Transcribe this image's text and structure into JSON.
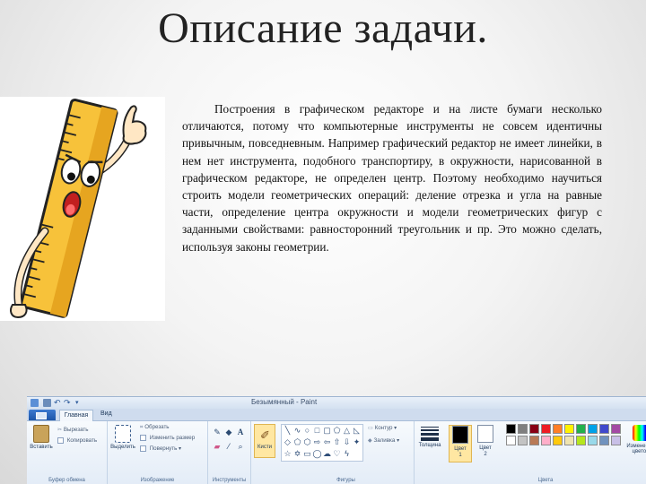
{
  "slide": {
    "title": "Описание задачи.",
    "body": "Построения в графическом редакторе и на листе бумаги несколько отличаются, потому что компьютерные инструменты не совсем идентичны привычным, повседневным. Например графический редактор не имеет линейки, в нем нет инструмента, подобного транспортиру, в окружности, нарисованной в графическом редакторе, не определен центр. Поэтому необходимо научиться строить модели геометрических операций: деление отрезка и угла на равные части, определение центра окружности и модели геометрических фигур с заданными свойствами: равносторонний треугольник и пр.  Это можно сделать, используя законы геометрии."
  },
  "paint": {
    "window_title": "Безымянный - Paint",
    "tabs": {
      "home": "Главная",
      "view": "Вид"
    },
    "clipboard": {
      "paste": "Вставить",
      "cut": "Вырезать",
      "copy": "Копировать",
      "group": "Буфер обмена"
    },
    "image": {
      "select": "Выделить",
      "crop": "Обрезать",
      "resize": "Изменить размер",
      "rotate": "Повернуть",
      "group": "Изображение"
    },
    "tools": {
      "group": "Инструменты",
      "brushes": "Кисти",
      "text_icon": "A"
    },
    "shapes": {
      "outline": "Контур",
      "fill": "Заливка",
      "group": "Фигуры"
    },
    "size": {
      "label": "Толщина"
    },
    "colors": {
      "color1": "Цвет\n1",
      "color2": "Цвет\n2",
      "edit": "Изменение цветов",
      "group": "Цвета",
      "color1_value": "#000000",
      "color2_value": "#ffffff",
      "palette_row1": [
        "#000000",
        "#7f7f7f",
        "#880015",
        "#ed1c24",
        "#ff7f27",
        "#fff200",
        "#22b14c",
        "#00a2e8",
        "#3f48cc",
        "#a349a4"
      ],
      "palette_row2": [
        "#ffffff",
        "#c3c3c3",
        "#b97a57",
        "#ffaec9",
        "#ffc90e",
        "#efe4b0",
        "#b5e61d",
        "#99d9ea",
        "#7092be",
        "#c8bfe7"
      ]
    }
  }
}
